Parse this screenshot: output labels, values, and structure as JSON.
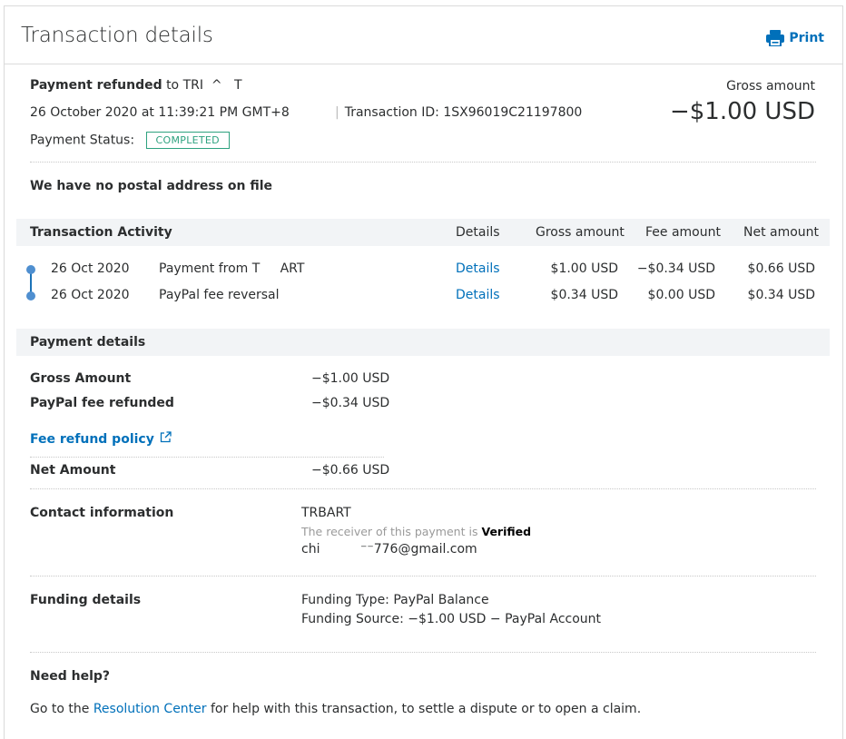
{
  "header": {
    "title": "Transaction details",
    "print_label": "Print"
  },
  "summary": {
    "refund_label": "Payment refunded",
    "refund_to": "to TRI  ^   T",
    "datetime": "26 October 2020 at 11:39:21 PM GMT+8",
    "transaction_id": "Transaction ID: 1SX96019C21197800",
    "gross_label": "Gross amount",
    "gross_value": "−$1.00 USD",
    "status_label": "Payment Status:",
    "status_value": "COMPLETED",
    "postal": "We have no postal address on file"
  },
  "activity": {
    "heading": "Transaction Activity",
    "columns": {
      "details": "Details",
      "gross": "Gross amount",
      "fee": "Fee amount",
      "net": "Net amount"
    },
    "rows": [
      {
        "date": "26 Oct 2020",
        "description": "Payment from T     ART",
        "details": "Details",
        "gross": "$1.00 USD",
        "fee": "−$0.34 USD",
        "net": "$0.66 USD"
      },
      {
        "date": "26 Oct 2020",
        "description": "PayPal fee reversal",
        "details": "Details",
        "gross": "$0.34 USD",
        "fee": "$0.00 USD",
        "net": "$0.34 USD"
      }
    ]
  },
  "payment_details": {
    "heading": "Payment details",
    "gross_label": "Gross Amount",
    "gross_value": "−$1.00 USD",
    "fee_label": "PayPal fee refunded",
    "fee_value": "−$0.34 USD",
    "policy_link": "Fee refund policy",
    "net_label": "Net Amount",
    "net_value": "−$0.66 USD"
  },
  "contact": {
    "label": "Contact information",
    "name": "TRBART",
    "verified_prefix": "The receiver of this payment is",
    "verified_value": "Verified",
    "email": "chi          ⁻⁻776@gmail.com"
  },
  "funding": {
    "label": "Funding details",
    "type": "Funding Type: PayPal Balance",
    "source": "Funding Source: −$1.00 USD − PayPal Account"
  },
  "help": {
    "heading": "Need help?",
    "text_before": "Go to the",
    "link": "Resolution Center",
    "text_after": "for help with this transaction, to settle a dispute or to open a claim."
  },
  "colors": {
    "link": "#0070ba",
    "status": "#2ea27f",
    "band": "#f2f4f6"
  },
  "icons": {
    "print": "printer-icon",
    "external": "external-link-icon"
  }
}
